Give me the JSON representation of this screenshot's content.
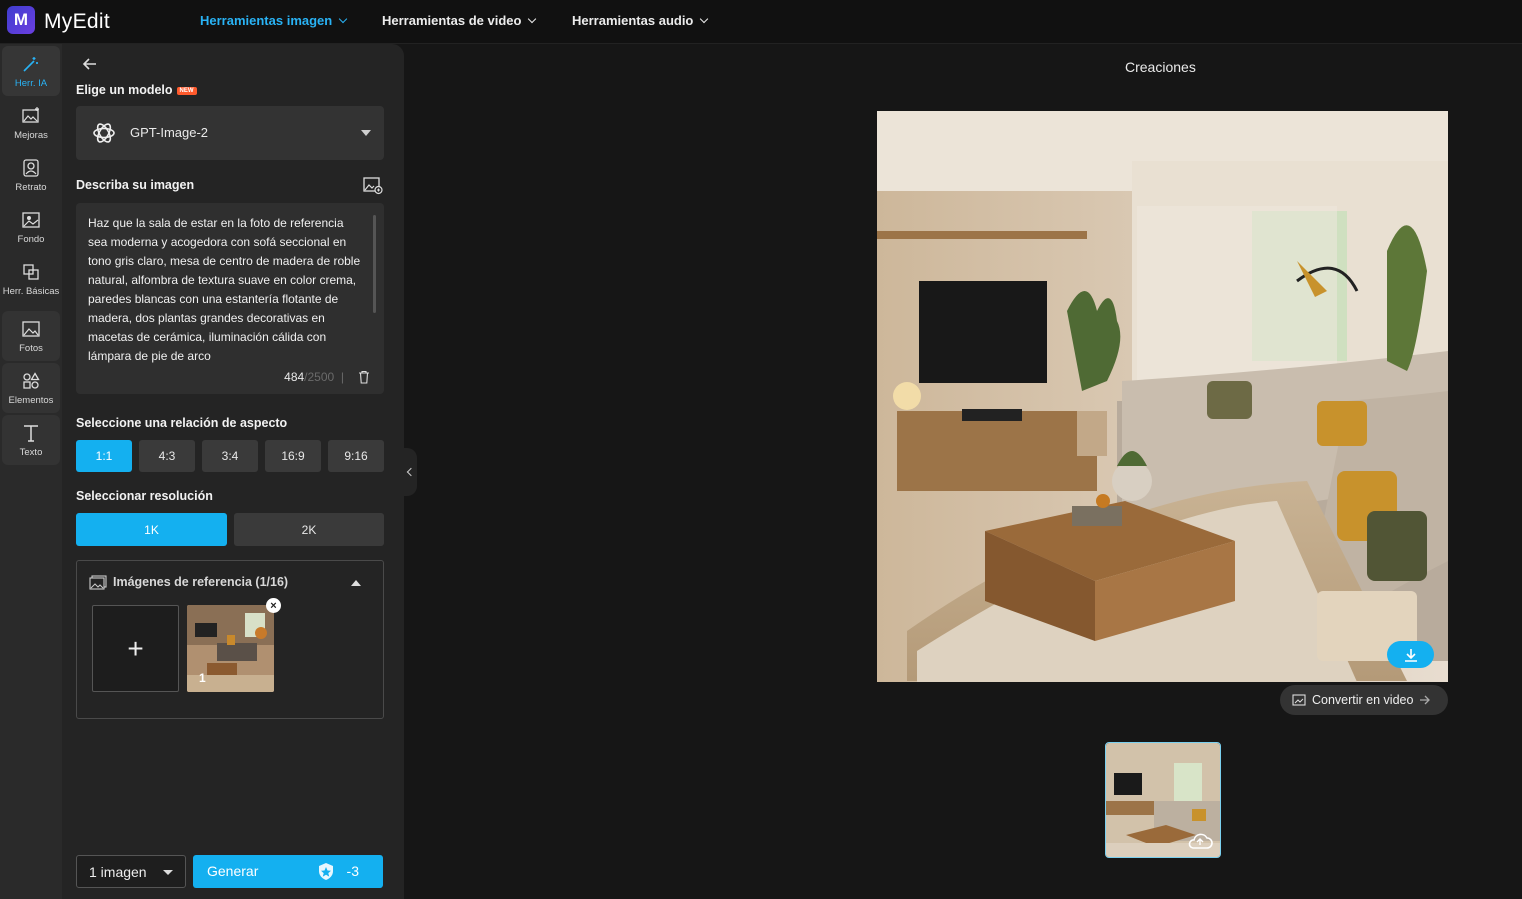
{
  "app": {
    "logo_letter": "M",
    "name": "MyEdit"
  },
  "nav": [
    {
      "label": "Herramientas imagen",
      "active": true
    },
    {
      "label": "Herramientas de video",
      "active": false
    },
    {
      "label": "Herramientas audio",
      "active": false
    }
  ],
  "rail": [
    {
      "label": "Herr. IA",
      "icon": "magic-wand-icon",
      "active": true
    },
    {
      "label": "Mejoras",
      "icon": "image-enhance-icon"
    },
    {
      "label": "Retrato",
      "icon": "portrait-icon"
    },
    {
      "label": "Fondo",
      "icon": "background-icon"
    },
    {
      "label": "Herr. Básicas",
      "icon": "crop-icon"
    },
    {
      "label": "Fotos",
      "icon": "photo-icon"
    },
    {
      "label": "Elementos",
      "icon": "elements-icon"
    },
    {
      "label": "Texto",
      "icon": "text-icon"
    }
  ],
  "panel": {
    "model_heading": "Elige un modelo",
    "new_badge": "NEW",
    "model_name": "GPT-Image-2",
    "describe_heading": "Describa su imagen",
    "prompt": "Haz que la sala de estar en la foto de referencia sea moderna y acogedora con sofá seccional en tono gris claro, mesa de centro de madera de roble natural, alfombra de textura suave en color crema, paredes blancas con una estantería flotante de madera, dos plantas grandes decorativas en macetas de cerámica, iluminación cálida con lámpara de pie de arco",
    "char_count": "484",
    "char_max": "/2500",
    "ratio_heading": "Seleccione una relación de aspecto",
    "ratios": [
      "1:1",
      "4:3",
      "3:4",
      "16:9",
      "9:16"
    ],
    "ratio_selected": "1:1",
    "resolution_heading": "Seleccionar resolución",
    "resolutions": [
      "1K",
      "2K"
    ],
    "resolution_selected": "1K",
    "reference_heading": "Imágenes de referencia (1/16)",
    "add_symbol": "+",
    "reference_thumb_index": "1",
    "image_count": "1 imagen",
    "generate_label": "Generar",
    "generate_cost": "-3"
  },
  "main": {
    "title": "Creaciones",
    "convert_video": "Convertir en video"
  },
  "colors": {
    "accent": "#14b0f0",
    "nav_active": "#29b3f5",
    "badge": "#ff5a2c"
  }
}
